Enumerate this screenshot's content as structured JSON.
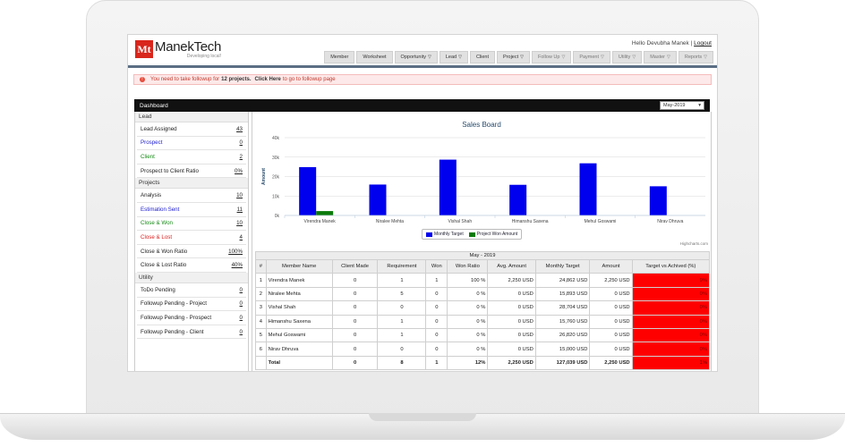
{
  "app": {
    "logo_mark": "Mt",
    "name": "ManekTech",
    "tagline": "Developing local!"
  },
  "user": {
    "greeting": "Hello Devubha Manek |",
    "logout": "Logout"
  },
  "nav": [
    {
      "label": "Member",
      "dropdown": false,
      "dim": false
    },
    {
      "label": "Worksheet",
      "dropdown": false,
      "dim": false
    },
    {
      "label": "Opportunity",
      "dropdown": true,
      "dim": false
    },
    {
      "label": "Lead",
      "dropdown": true,
      "dim": false
    },
    {
      "label": "Client",
      "dropdown": false,
      "dim": false
    },
    {
      "label": "Project",
      "dropdown": true,
      "dim": false
    },
    {
      "label": "Follow Up",
      "dropdown": true,
      "dim": true
    },
    {
      "label": "Payment",
      "dropdown": true,
      "dim": true
    },
    {
      "label": "Utility",
      "dropdown": true,
      "dim": true
    },
    {
      "label": "Master",
      "dropdown": true,
      "dim": true
    },
    {
      "label": "Reports",
      "dropdown": true,
      "dim": true
    }
  ],
  "alert": {
    "icon": "exclamation-icon",
    "text_pre": "You need to take followup for",
    "count": "12 projects.",
    "link": "Click Here",
    "text_post": "to go to followup page"
  },
  "dashboard": {
    "title": "Dashboard",
    "month": "May-2019"
  },
  "sidebar": {
    "lead_title": "Lead",
    "lead_items": [
      {
        "label": "Lead Assigned",
        "value": "43",
        "color": "default"
      },
      {
        "label": "Prospect",
        "value": "0",
        "color": "blue"
      },
      {
        "label": "Client",
        "value": "2",
        "color": "green"
      },
      {
        "label": "Prospect to Client Ratio",
        "value": "0%",
        "color": "default"
      }
    ],
    "projects_title": "Projects",
    "project_items": [
      {
        "label": "Analysis",
        "value": "10",
        "color": "default"
      },
      {
        "label": "Estimation Sent",
        "value": "11",
        "color": "blue"
      },
      {
        "label": "Close & Won",
        "value": "10",
        "color": "green"
      },
      {
        "label": "Close & Lost",
        "value": "4",
        "color": "red"
      },
      {
        "label": "Close & Won Ratio",
        "value": "100%",
        "color": "default"
      },
      {
        "label": "Close & Lost Ratio",
        "value": "40%",
        "color": "default"
      }
    ],
    "utility_title": "Utility",
    "utility_items": [
      {
        "label": "ToDo Pending",
        "value": "0",
        "color": "default"
      },
      {
        "label": "Followup Pending - Project",
        "value": "0",
        "color": "default"
      },
      {
        "label": "Followup Pending - Prospect",
        "value": "0",
        "color": "default"
      },
      {
        "label": "Followup Pending - Client",
        "value": "0",
        "color": "default"
      }
    ]
  },
  "chart_data": {
    "type": "bar",
    "title": "Sales Board",
    "ylabel": "Amount",
    "ylim": [
      0,
      40000
    ],
    "yticks": [
      "0k",
      "10k",
      "20k",
      "30k",
      "40k"
    ],
    "categories": [
      "Virendra Manek",
      "Niralee Mehta",
      "Vishal Shah",
      "Himanshu Saxena",
      "Mehul Goswami",
      "Nirav Dhruva"
    ],
    "series": [
      {
        "name": "Monthly Target",
        "color": "#0000ee",
        "values": [
          24862,
          15893,
          28704,
          15760,
          26820,
          15000
        ]
      },
      {
        "name": "Project Won Amount",
        "color": "#0a7a0a",
        "values": [
          2250,
          0,
          0,
          0,
          0,
          0
        ]
      }
    ],
    "grid": true,
    "legend": "bottom-center",
    "credit": "Highcharts.com"
  },
  "table": {
    "period": "May - 2019",
    "headers": [
      "#",
      "Member Name",
      "Client Made",
      "Requirement",
      "Won",
      "Won Ratio",
      "Avg. Amount",
      "Monthly Target",
      "Amount",
      "Target vs Achived (%)"
    ],
    "rows": [
      [
        "1",
        "Virendra Manek",
        "0",
        "1",
        "1",
        "100 %",
        "2,250 USD",
        "24,862 USD",
        "2,250 USD",
        "9%"
      ],
      [
        "2",
        "Niralee Mehta",
        "0",
        "5",
        "0",
        "0 %",
        "0 USD",
        "15,893 USD",
        "0 USD",
        "0%"
      ],
      [
        "3",
        "Vishal Shah",
        "0",
        "0",
        "0",
        "0 %",
        "0 USD",
        "28,704 USD",
        "0 USD",
        "0%"
      ],
      [
        "4",
        "Himanshu Saxena",
        "0",
        "1",
        "0",
        "0 %",
        "0 USD",
        "15,760 USD",
        "0 USD",
        "0%"
      ],
      [
        "5",
        "Mehul Goswami",
        "0",
        "1",
        "0",
        "0 %",
        "0 USD",
        "26,820 USD",
        "0 USD",
        "0%"
      ],
      [
        "6",
        "Nirav Dhruva",
        "0",
        "0",
        "0",
        "0 %",
        "0 USD",
        "15,000 USD",
        "0 USD",
        "0%"
      ]
    ],
    "total": [
      "",
      "Total",
      "0",
      "8",
      "1",
      "12%",
      "2,250 USD",
      "127,039 USD",
      "2,250 USD",
      "1%"
    ]
  },
  "colors": {
    "accent_rule": "#5b6f84",
    "alert_bg": "#fde9e9",
    "target_cell": "#ff0000"
  }
}
